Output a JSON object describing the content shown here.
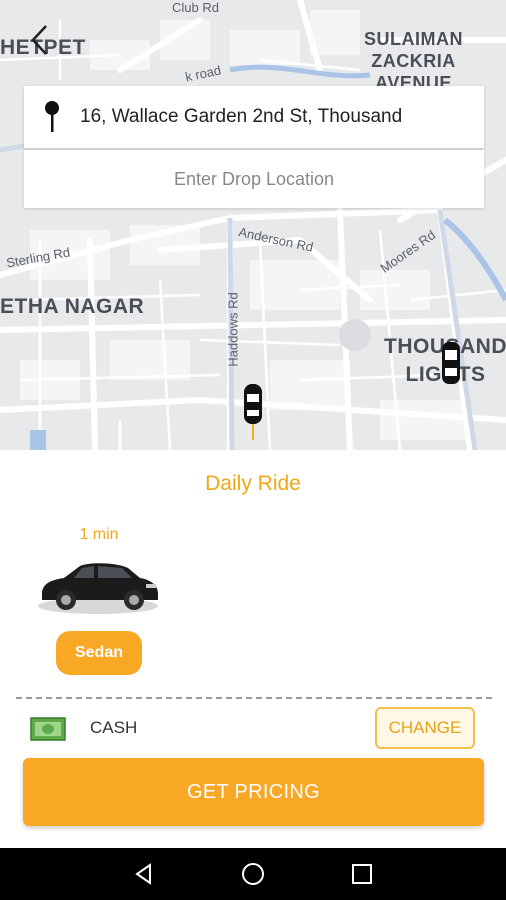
{
  "map": {
    "areas": {
      "chetpet": "HETPET",
      "sulaiman": [
        "SULAIMAN",
        "ZACKRIA",
        "AVENUE"
      ],
      "ethanagar": "ETHA NAGAR",
      "thousand": [
        "THOUSAND",
        "LIGHTS"
      ]
    },
    "streets": {
      "club": "Club Rd",
      "park": "k road",
      "sterling": "Sterling Rd",
      "anderson": "Anderson Rd",
      "moores": "Moores Rd",
      "haddows": "Haddows Rd"
    }
  },
  "pickup": {
    "address": "16, Wallace Garden 2nd St, Thousand"
  },
  "drop": {
    "placeholder": "Enter Drop Location"
  },
  "ride": {
    "title": "Daily Ride",
    "eta": "1 min",
    "vehicle_label": "Sedan"
  },
  "payment": {
    "method": "CASH",
    "change_label": "CHANGE"
  },
  "action": {
    "pricing_label": "GET PRICING"
  },
  "colors": {
    "accent": "#f9a825",
    "accent_text": "#f0a815"
  },
  "icons": {
    "back": "chevron-left-icon",
    "pin": "location-pin-icon",
    "cash": "cash-icon",
    "nav_back": "triangle-back-icon",
    "nav_home": "circle-home-icon",
    "nav_recents": "square-recents-icon"
  }
}
